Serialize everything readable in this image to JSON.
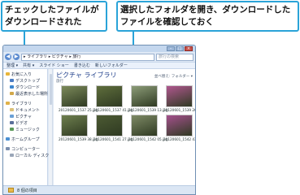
{
  "callouts": {
    "left": "チェックしたファイルがダウンロードされた",
    "right": "選択したフォルダを開き、ダウンロードしたファイルを確認しておく"
  },
  "window": {
    "address_path": "▸ ライブラリ ▸ ピクチャ ▸ 旅行",
    "search_placeholder": "旅行の検索",
    "toolbar": [
      "整理 ▾",
      "共有 ▾",
      "スライド ショー",
      "書き込む",
      "新しいフォルダー"
    ],
    "sidebar": {
      "favorites": {
        "label": "お気に入り",
        "items": [
          "デスクトップ",
          "ダウンロード",
          "最近表示した場所"
        ]
      },
      "libraries": {
        "label": "ライブラリ",
        "items": [
          "ドキュメント",
          "ピクチャ",
          "ビデオ",
          "ミュージック"
        ]
      },
      "homegroup": "ホームグループ",
      "computer": {
        "label": "コンピューター",
        "items": [
          "ローカル ディスク"
        ]
      }
    },
    "content": {
      "title": "ピクチャ ライブラリ",
      "subtitle": "旅行",
      "arrange_label": "並べ替え: フォルダー ▾",
      "files": [
        {
          "name": "20120601_1537 25.jpg",
          "color": "#7c8a5a"
        },
        {
          "name": "20120601_1537 41.jpg",
          "color": "#5f6e3c"
        },
        {
          "name": "20120601_1539 13.jpg",
          "color": "#8c9c78"
        },
        {
          "name": "20120601_1539 26.jpg",
          "color": "#b0578f"
        },
        {
          "name": "20120601_1539 38.jpg",
          "color": "#6e7f4e"
        },
        {
          "name": "20120601_1541 27.jpg",
          "color": "#4c5a33"
        },
        {
          "name": "20120601_1542 05.jpg",
          "color": "#7e8a66"
        },
        {
          "name": "20120601_1542 43.jpg",
          "color": "#a4508c"
        }
      ]
    },
    "status": "8 個の項目"
  },
  "colors": {
    "callout_border": "#2aa3d8",
    "lib_title": "#1e3e8a"
  }
}
